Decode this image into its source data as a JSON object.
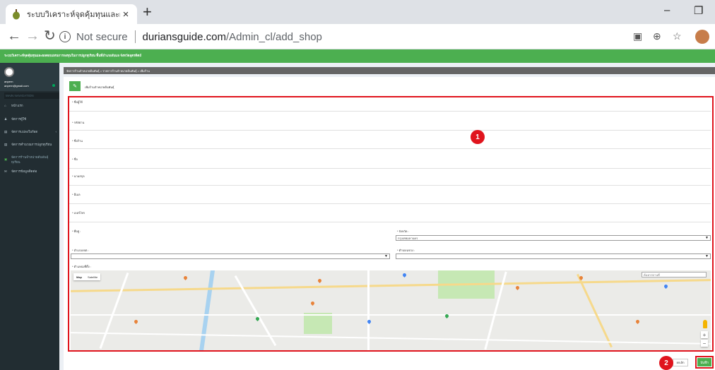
{
  "browser": {
    "tab_title": "ระบบวิเคราะห์จุดคุ้มทุนและผลตอบแทน",
    "tab_close": "×",
    "new_tab": "+",
    "not_secure": "Not secure",
    "url_host": "duriansguide.com",
    "url_path": "/Admin_cl/add_shop",
    "window_minimize": "–",
    "window_restore": "❐"
  },
  "app": {
    "header_text": "ระบบวิเคราะห์จุดคุ้มทุนและผลตอบแทนการลงทุนในการปลูกทุเรียน พื้นที่อำเภอลับแล จังหวัดอุตรดิตถ์",
    "accent": "#4caf50"
  },
  "sidebar": {
    "user_name": "anpern",
    "user_email": "anpern@gmail.com",
    "section_title": "MAIN NAVIGATION",
    "items": [
      {
        "label": "หน้าแรก",
        "icon": "home-icon"
      },
      {
        "label": "จัดการผู้ใช้",
        "icon": "user-icon"
      },
      {
        "label": "จัดการแปลงในร้อด",
        "icon": "list-icon"
      },
      {
        "label": "จัดการคำนวณการปลูกทุเรียน",
        "icon": "list-icon"
      },
      {
        "label": "จัดการร้านจำหน่ายต้นพันธุ์ทุเรียน",
        "icon": "shop-icon"
      },
      {
        "label": "จัดการข้อมูลติดต่อ",
        "icon": "contact-icon"
      }
    ]
  },
  "content": {
    "breadcrumb": "จัดการร้านจำหน่ายต้นพันธุ์ > รายการร้านจำหน่ายต้นพันธุ์ > เพิ่มร้าน",
    "box_title": "เพิ่มร้านจำหน่ายต้นพันธุ์",
    "fields": {
      "owner": "* ชื่อผู้ใช้",
      "password": "* รหัสผ่าน",
      "shop_name": "* ชื่อร้าน",
      "name": "* ชื่อ",
      "surname": "* นามสกุล",
      "email": "* อีเมล",
      "phone": "* เบอร์โทร",
      "address": "* ที่อยู่ :",
      "province": "* จังหวัด :",
      "district": "* อำเภอ/เขต :",
      "subdistrict": "* ตำบล/แขวง :",
      "location": "* ตำแหน่งที่ตั้ง :"
    },
    "province_value": "กรุงเทพมหานคร",
    "district_value": "",
    "subdistrict_value": ""
  },
  "map": {
    "type_map": "Map",
    "type_satellite": "Satellite",
    "search_placeholder": "ค้นหาสถานที่"
  },
  "actions": {
    "cancel": "ยกเลิก",
    "save": "บันทึก"
  },
  "annotations": {
    "one": "1",
    "two": "2"
  }
}
